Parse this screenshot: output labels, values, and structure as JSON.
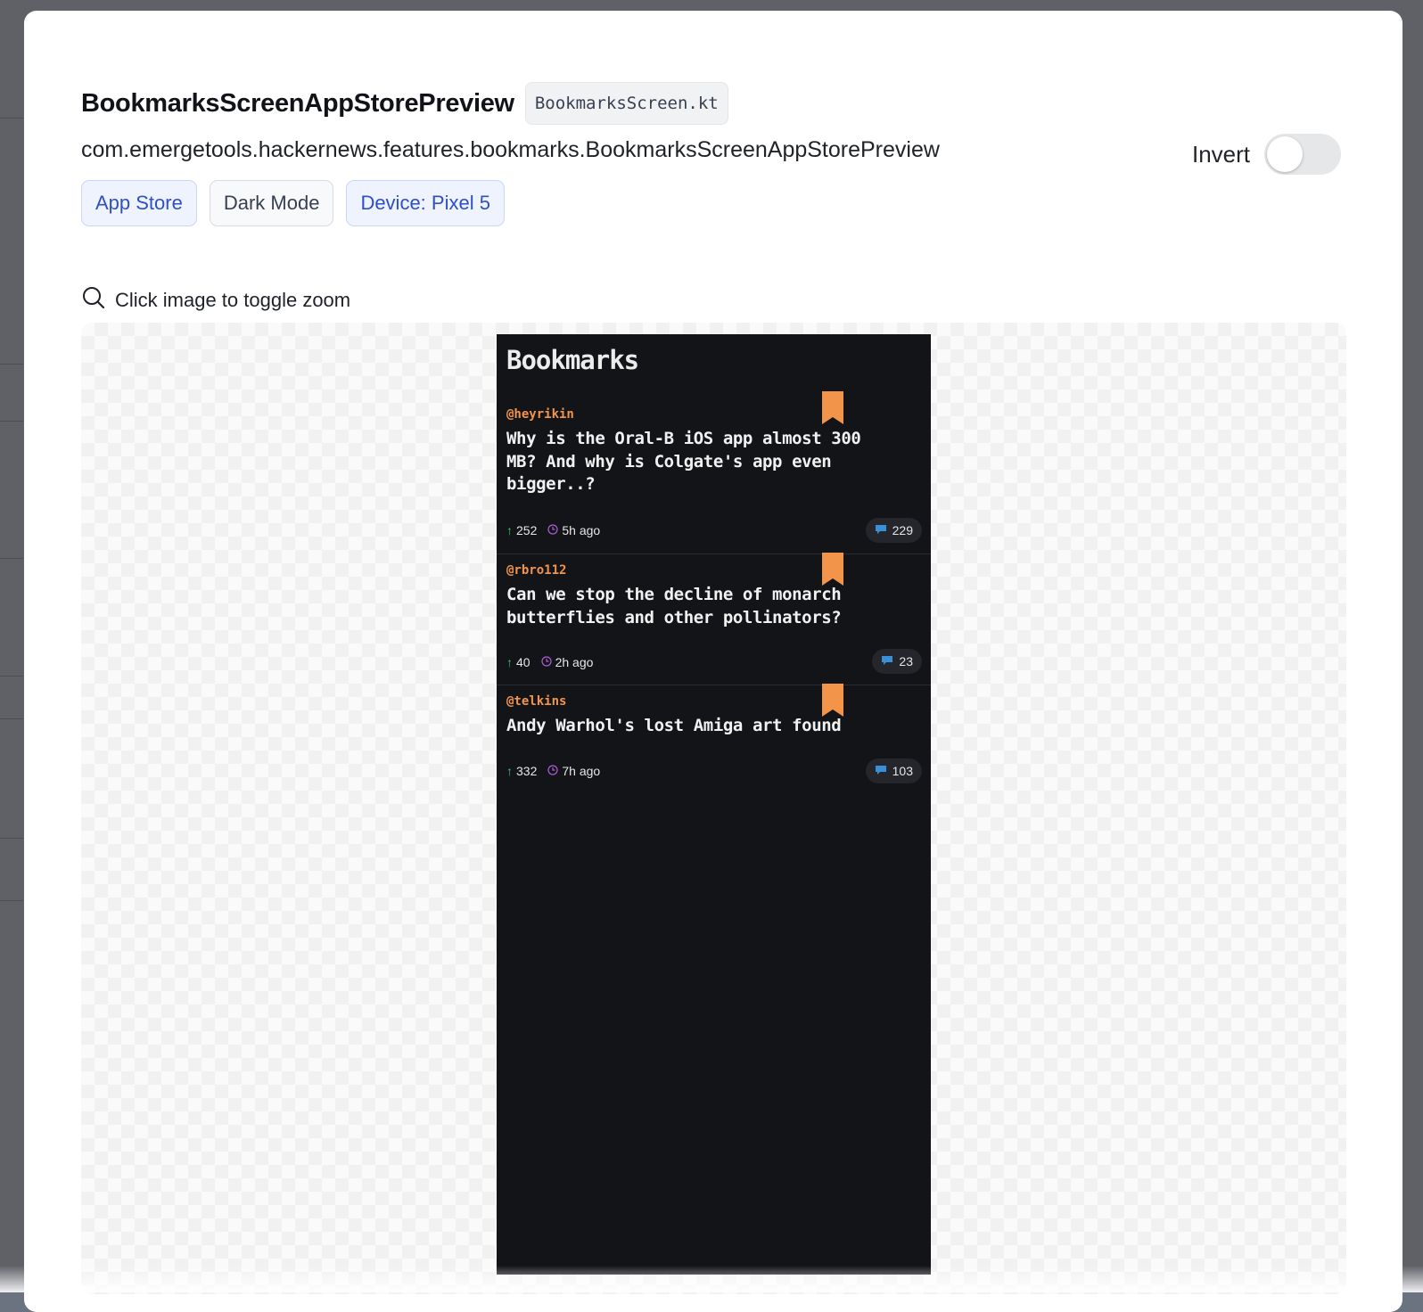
{
  "preview": {
    "title": "BookmarksScreenAppStorePreview",
    "file_name": "BookmarksScreen.kt",
    "fully_qualified_name": "com.emergetools.hackernews.features.bookmarks.BookmarksScreenAppStorePreview",
    "tags": [
      "App Store",
      "Dark Mode",
      "Device: Pixel 5"
    ],
    "invert_label": "Invert",
    "invert_on": false,
    "zoom_hint": "Click image to toggle zoom"
  },
  "screen": {
    "title": "Bookmarks",
    "stories": [
      {
        "author": "@heyrikin",
        "title": "Why is the Oral-B iOS app almost 300 MB? And why is Colgate's app even bigger..?",
        "points": "252",
        "time": "5h ago",
        "comments": "229"
      },
      {
        "author": "@rbro112",
        "title": "Can we stop the decline of monarch butterflies and other pollinators?",
        "points": "40",
        "time": "2h ago",
        "comments": "23"
      },
      {
        "author": "@telkins",
        "title": "Andy Warhol's lost Amiga art found",
        "points": "332",
        "time": "7h ago",
        "comments": "103"
      }
    ]
  },
  "colors": {
    "accent_orange": "#f2944a",
    "upvote_green": "#35c46b",
    "clock_purple": "#b05cd6",
    "comment_blue": "#3a8fd6",
    "active_tag_blue": "#2f4fc7"
  }
}
